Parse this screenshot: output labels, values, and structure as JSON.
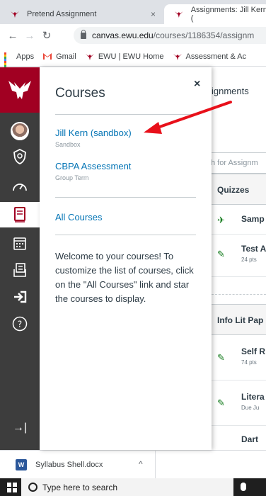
{
  "browser": {
    "tabs": [
      {
        "title": "Pretend Assignment",
        "close": "×"
      },
      {
        "title": "Assignments: Jill Kern ("
      }
    ],
    "url_host": "canvas.ewu.edu",
    "url_path": "/courses/1186354/assignm",
    "bookmarks": [
      "Apps",
      "Gmail",
      "EWU | EWU Home",
      "Assessment & Ac"
    ]
  },
  "tray": {
    "title": "Courses",
    "close": "×",
    "courses": [
      {
        "name": "Jill Kern (sandbox)",
        "term": "Sandbox"
      },
      {
        "name": "CBPA Assessment",
        "term": "Group Term"
      }
    ],
    "all_courses": "All Courses",
    "message": "Welcome to your courses! To customize the list of courses, click on the \"All Courses\" link and star the courses to display."
  },
  "content": {
    "crumb": "ignments",
    "search_placeholder": "h for Assignm",
    "groups": [
      {
        "title": "Quizzes",
        "items": [
          {
            "name": "Samp",
            "meta": ""
          },
          {
            "name": "Test A",
            "meta": "24 pts"
          }
        ]
      },
      {
        "title": "Info Lit Pap",
        "items": [
          {
            "name": "Self R",
            "meta": "74 pts"
          },
          {
            "name": "Litera",
            "meta": "Due Ju"
          },
          {
            "name": "Dart",
            "meta": ""
          }
        ]
      }
    ]
  },
  "downloads": {
    "file": "Syllabus Shell.docx"
  },
  "taskbar": {
    "search": "Type here to search"
  },
  "colors": {
    "canvas_link": "#0374b5",
    "ewu_red": "#a10022",
    "nav_bg": "#3d3d3d",
    "annotation": "#e8101a"
  }
}
